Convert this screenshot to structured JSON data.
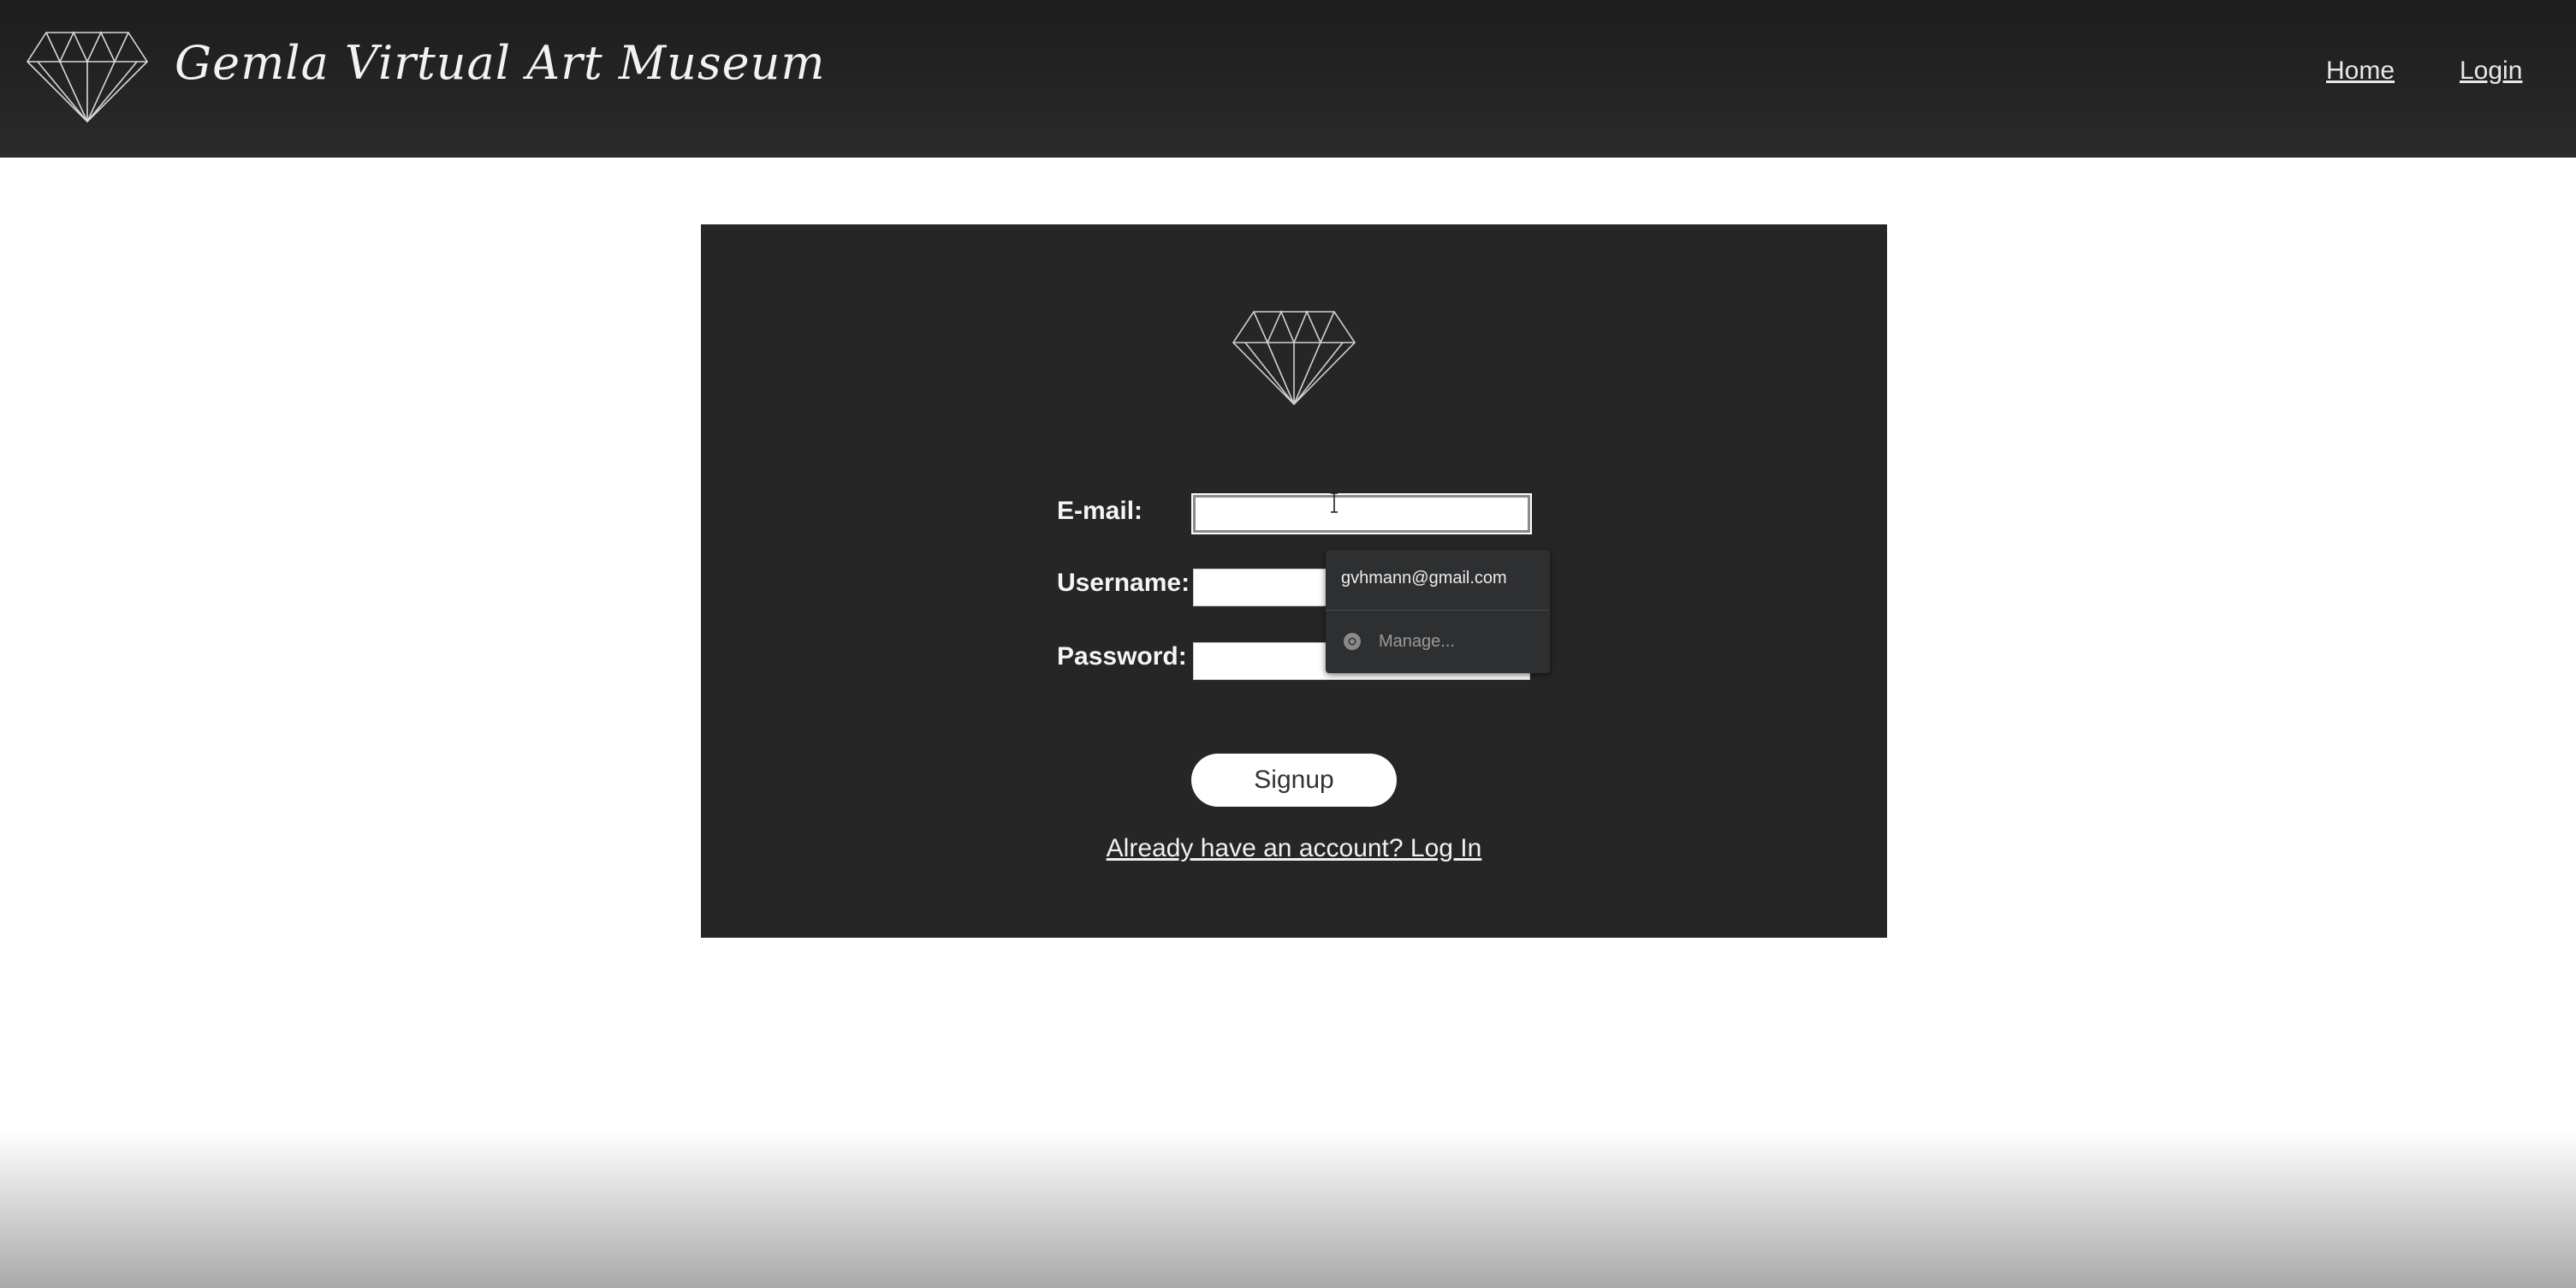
{
  "header": {
    "site_title": "Gemla Virtual Art Museum",
    "nav": {
      "home": "Home",
      "login": "Login"
    }
  },
  "form": {
    "email_label": "E-mail:",
    "username_label": "Username:",
    "password_label": "Password:",
    "email_value": "",
    "username_value": "",
    "password_value": "",
    "signup_label": "Signup",
    "login_link": "Already have an account? Log In"
  },
  "autofill": {
    "suggestion": "gvhmann@gmail.com",
    "manage_label": "Manage..."
  },
  "icons": {
    "logo": "diamond-icon",
    "manage": "chrome-icon"
  }
}
